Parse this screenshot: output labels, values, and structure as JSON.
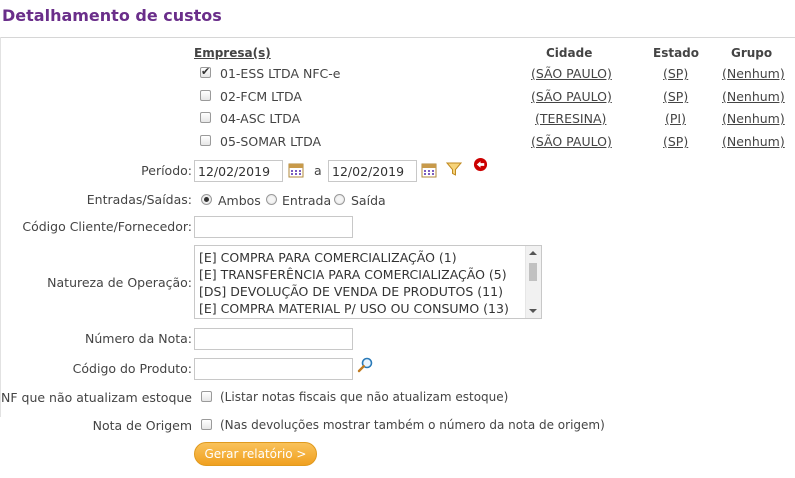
{
  "title": "Detalhamento de custos",
  "columns": {
    "empresa": "Empresa(s)",
    "cidade": "Cidade",
    "estado": "Estado",
    "grupo": "Grupo"
  },
  "companies": [
    {
      "name": "01-ESS LTDA NFC-e",
      "cidade": "(SÃO PAULO)",
      "estado": "(SP)",
      "grupo": "(Nenhum)",
      "checked": true
    },
    {
      "name": "02-FCM LTDA",
      "cidade": "(SÃO PAULO)",
      "estado": "(SP)",
      "grupo": "(Nenhum)",
      "checked": false
    },
    {
      "name": "04-ASC LTDA",
      "cidade": "(TERESINA)",
      "estado": "(PI)",
      "grupo": "(Nenhum)",
      "checked": false
    },
    {
      "name": "05-SOMAR LTDA",
      "cidade": "(SÃO PAULO)",
      "estado": "(SP)",
      "grupo": "(Nenhum)",
      "checked": false
    }
  ],
  "periodo": {
    "label": "Período:",
    "start": "12/02/2019",
    "sep": "a",
    "end": "12/02/2019"
  },
  "entradas": {
    "label": "Entradas/Saídas:",
    "options": [
      "Ambos",
      "Entrada",
      "Saída"
    ],
    "selected": "Ambos"
  },
  "codigo_cliente": {
    "label": "Código Cliente/Fornecedor:",
    "value": ""
  },
  "natureza": {
    "label": "Natureza de Operação:",
    "options": [
      "[E] COMPRA PARA COMERCIALIZAÇÃO (1)",
      "[E] TRANSFERÊNCIA PARA COMERCIALIZAÇÃO (5)",
      "[DS] DEVOLUÇÃO DE VENDA DE PRODUTOS (11)",
      "[E] COMPRA MATERIAL P/ USO OU CONSUMO (13)"
    ]
  },
  "numero_nota": {
    "label": "Número da Nota:",
    "value": ""
  },
  "codigo_produto": {
    "label": "Código do Produto:",
    "value": ""
  },
  "nf_estoque": {
    "label": "NF que não atualizam estoque",
    "note": "(Listar notas fiscais que não atualizam estoque)"
  },
  "nota_origem": {
    "label": "Nota de Origem",
    "note": "(Nas devoluções mostrar também o número da nota de origem)"
  },
  "button": {
    "label": "Gerar relatório >"
  },
  "colors": {
    "title": "#6a2e8a",
    "button": "#f0a020",
    "remove": "#cc0000"
  }
}
